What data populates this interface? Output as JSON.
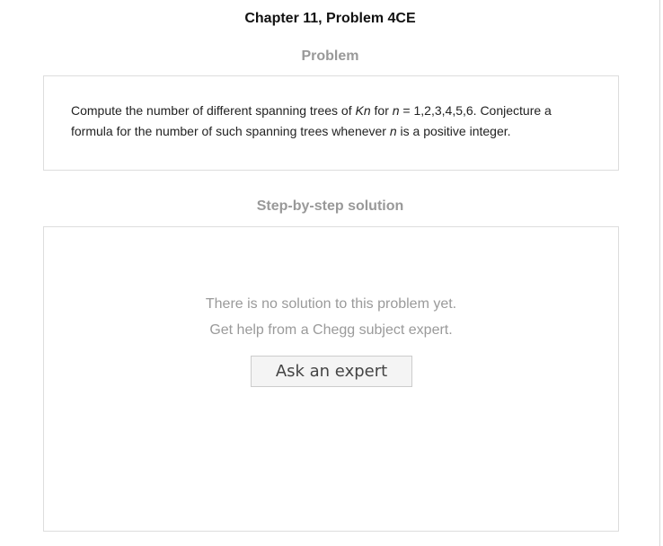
{
  "chapter_title": "Chapter 11, Problem 4CE",
  "problem": {
    "heading": "Problem",
    "text_parts": {
      "p1": "Compute the number of different spanning trees of ",
      "k": "Kn",
      "p2": " for ",
      "n1": "n",
      "p3": " = 1,2,3,4,5,6. Conjecture a formula for the number of such spanning trees whenever ",
      "n2": "n",
      "p4": " is a positive integer."
    }
  },
  "solution": {
    "heading": "Step-by-step solution",
    "no_solution_line1": "There is no solution to this problem yet.",
    "no_solution_line2": "Get help from a Chegg subject expert.",
    "ask_button_label": "Ask an expert"
  }
}
